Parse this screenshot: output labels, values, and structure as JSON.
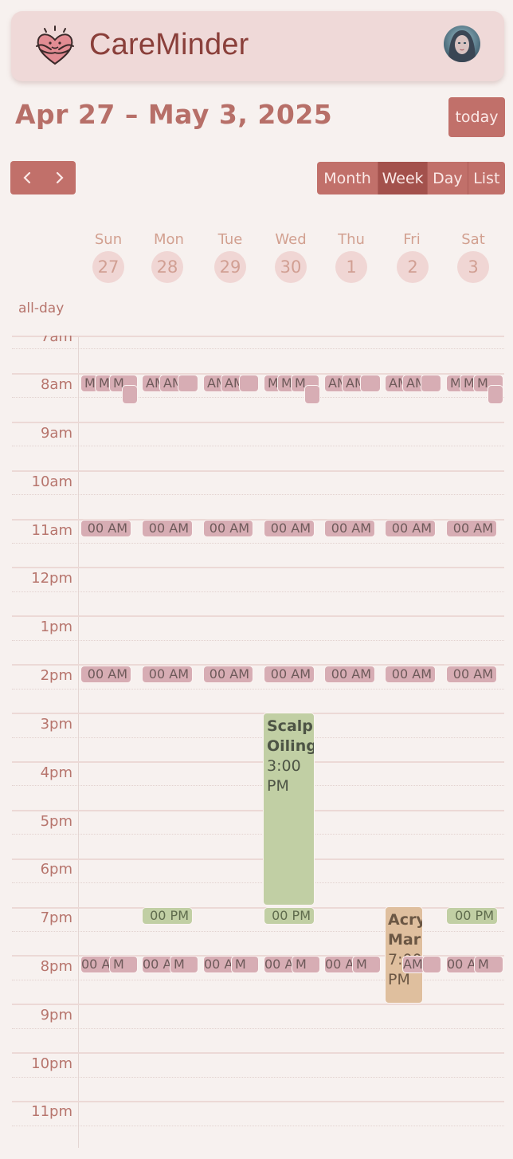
{
  "app": {
    "title": "CareMinder",
    "logo_icon": "heart-hug-icon",
    "avatar_icon": "user-avatar-icon"
  },
  "toolbar": {
    "range_title": "Apr 27 – May 3, 2025",
    "today_label": "today",
    "prev_icon": "chevron-left-icon",
    "next_icon": "chevron-right-icon",
    "views": [
      {
        "label": "Month",
        "active": false
      },
      {
        "label": "Week",
        "active": true
      },
      {
        "label": "Day",
        "active": false
      },
      {
        "label": "List",
        "active": false
      }
    ]
  },
  "days": [
    {
      "name": "Sun",
      "num": "27"
    },
    {
      "name": "Mon",
      "num": "28"
    },
    {
      "name": "Tue",
      "num": "29"
    },
    {
      "name": "Wed",
      "num": "30"
    },
    {
      "name": "Thu",
      "num": "1"
    },
    {
      "name": "Fri",
      "num": "2"
    },
    {
      "name": "Sat",
      "num": "3"
    }
  ],
  "allday_label": "all-day",
  "hours": [
    "7am",
    "8am",
    "9am",
    "10am",
    "11am",
    "12pm",
    "1pm",
    "2pm",
    "3pm",
    "4pm",
    "5pm",
    "6pm",
    "7pm",
    "8pm",
    "9pm",
    "10pm",
    "11pm"
  ],
  "events": {
    "am_truncated": "M",
    "am_truncated_alt": "AM",
    "eleven_label": "00 AM",
    "two_label": "00 AM",
    "seven_pm_label": "00 PM",
    "eight_pm_label_a": "00 AM",
    "eight_pm_label_b": "M",
    "scalp": {
      "title": "Scalp Oiling",
      "time": "3:00 PM"
    },
    "acrylic": {
      "title": "Acrylic Mar",
      "time": "7:00 PM"
    }
  },
  "colors": {
    "accent": "#c1706a",
    "event_pink": "#d7adb4",
    "event_green": "#c1cfa4",
    "event_tan": "#dfbf9e",
    "header_bg": "#efd9d8",
    "page_bg": "#f7f1ef"
  }
}
